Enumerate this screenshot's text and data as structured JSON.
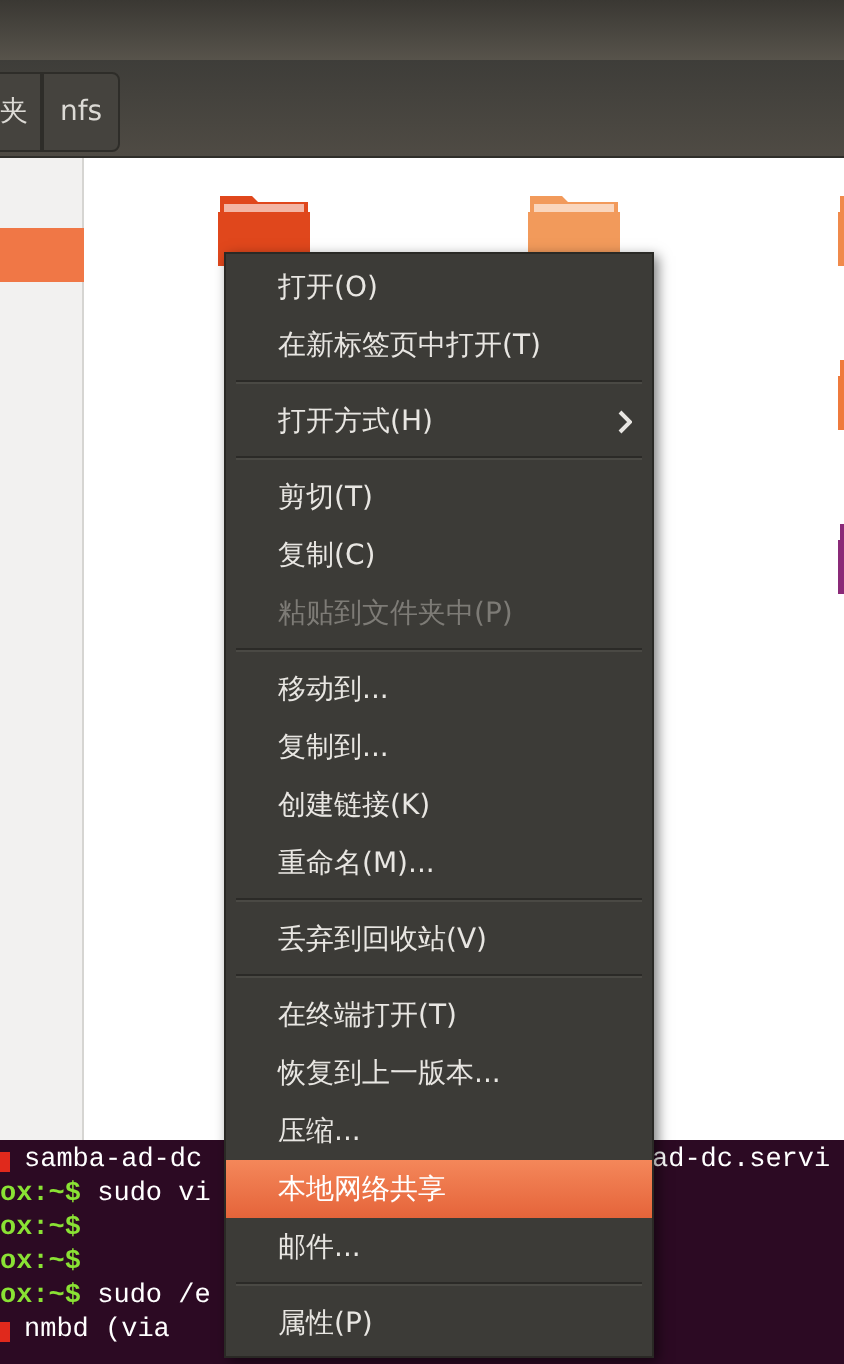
{
  "pathbar": {
    "buttons": [
      {
        "label": "夹",
        "selected": false
      },
      {
        "label": "nfs",
        "selected": false
      }
    ]
  },
  "sidebar": {
    "items": [
      {
        "selected": true
      }
    ]
  },
  "folders": [
    {
      "color": "#e0471c"
    },
    {
      "color": "#f29a5b"
    },
    {
      "color": "#f08a4b"
    },
    {
      "color": "#ef7a3c"
    },
    {
      "color": "#8a2a78"
    }
  ],
  "terminal": {
    "lines": [
      {
        "kind": "status",
        "text": "samba-ad-dc",
        "tail": "ad-dc.servi"
      },
      {
        "kind": "prompt",
        "prompt": "ox:~$",
        "text": " sudo vi"
      },
      {
        "kind": "prompt",
        "prompt": "ox:~$"
      },
      {
        "kind": "prompt",
        "prompt": "ox:~$"
      },
      {
        "kind": "prompt",
        "prompt": "ox:~$",
        "text": " sudo /e"
      },
      {
        "kind": "status",
        "text": "nmbd (via"
      }
    ]
  },
  "context_menu": {
    "items": [
      {
        "kind": "item",
        "label": "打开(O)",
        "disabled": false,
        "selected": false,
        "submenu": false
      },
      {
        "kind": "item",
        "label": "在新标签页中打开(T)",
        "disabled": false,
        "selected": false,
        "submenu": false
      },
      {
        "kind": "separator"
      },
      {
        "kind": "item",
        "label": "打开方式(H)",
        "disabled": false,
        "selected": false,
        "submenu": true
      },
      {
        "kind": "separator"
      },
      {
        "kind": "item",
        "label": "剪切(T)",
        "disabled": false,
        "selected": false,
        "submenu": false
      },
      {
        "kind": "item",
        "label": "复制(C)",
        "disabled": false,
        "selected": false,
        "submenu": false
      },
      {
        "kind": "item",
        "label": "粘贴到文件夹中(P)",
        "disabled": true,
        "selected": false,
        "submenu": false
      },
      {
        "kind": "separator"
      },
      {
        "kind": "item",
        "label": "移动到...",
        "disabled": false,
        "selected": false,
        "submenu": false
      },
      {
        "kind": "item",
        "label": "复制到...",
        "disabled": false,
        "selected": false,
        "submenu": false
      },
      {
        "kind": "item",
        "label": "创建链接(K)",
        "disabled": false,
        "selected": false,
        "submenu": false
      },
      {
        "kind": "item",
        "label": "重命名(M)...",
        "disabled": false,
        "selected": false,
        "submenu": false
      },
      {
        "kind": "separator"
      },
      {
        "kind": "item",
        "label": "丢弃到回收站(V)",
        "disabled": false,
        "selected": false,
        "submenu": false
      },
      {
        "kind": "separator"
      },
      {
        "kind": "item",
        "label": "在终端打开(T)",
        "disabled": false,
        "selected": false,
        "submenu": false
      },
      {
        "kind": "item",
        "label": "恢复到上一版本...",
        "disabled": false,
        "selected": false,
        "submenu": false
      },
      {
        "kind": "item",
        "label": "压缩...",
        "disabled": false,
        "selected": false,
        "submenu": false
      },
      {
        "kind": "item",
        "label": "本地网络共享",
        "disabled": false,
        "selected": true,
        "submenu": false
      },
      {
        "kind": "item",
        "label": "邮件...",
        "disabled": false,
        "selected": false,
        "submenu": false
      },
      {
        "kind": "separator"
      },
      {
        "kind": "item",
        "label": "属性(P)",
        "disabled": false,
        "selected": false,
        "submenu": false
      }
    ]
  }
}
